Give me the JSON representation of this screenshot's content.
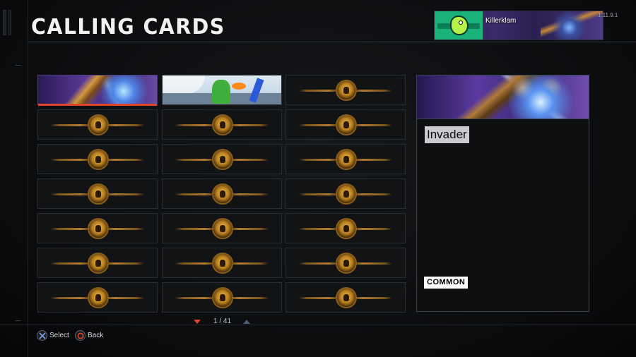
{
  "header": {
    "title": "CALLING CARDS",
    "version": "1.11.9.1"
  },
  "player": {
    "name": "Killerklam"
  },
  "grid": {
    "columns": 3,
    "rows": 7,
    "cards": [
      {
        "art": "invader",
        "locked": false,
        "selected": true
      },
      {
        "art": "monster",
        "locked": false,
        "selected": false
      },
      {
        "art": "locked-medal",
        "locked": true
      },
      {
        "art": "locked-medal",
        "locked": true
      },
      {
        "art": "locked-medal",
        "locked": true
      },
      {
        "art": "locked-medal",
        "locked": true
      },
      {
        "art": "locked-medal",
        "locked": true
      },
      {
        "art": "locked-medal",
        "locked": true
      },
      {
        "art": "locked-medal",
        "locked": true
      },
      {
        "art": "locked-medal",
        "locked": true
      },
      {
        "art": "locked-medal",
        "locked": true
      },
      {
        "art": "locked-medal",
        "locked": true
      },
      {
        "art": "locked-medal",
        "locked": true
      },
      {
        "art": "locked-medal",
        "locked": true
      },
      {
        "art": "locked-medal",
        "locked": true
      },
      {
        "art": "locked-medal",
        "locked": true
      },
      {
        "art": "locked-medal",
        "locked": true
      },
      {
        "art": "locked-medal",
        "locked": true
      },
      {
        "art": "locked-medal",
        "locked": true
      },
      {
        "art": "locked-medal",
        "locked": true
      },
      {
        "art": "locked-medal",
        "locked": true
      }
    ]
  },
  "pager": {
    "text": "1 / 41",
    "down_icon": "arrow-down-icon",
    "up_icon": "arrow-up-icon"
  },
  "detail": {
    "name": "Invader",
    "rarity": "COMMON"
  },
  "prompts": [
    {
      "button": "cross-button-icon",
      "label": "Select"
    },
    {
      "button": "circle-button-icon",
      "label": "Back"
    }
  ],
  "colors": {
    "accent_red": "#e0452b",
    "panel_border": "#3a4450",
    "medal_gold": "#f3c14b"
  }
}
